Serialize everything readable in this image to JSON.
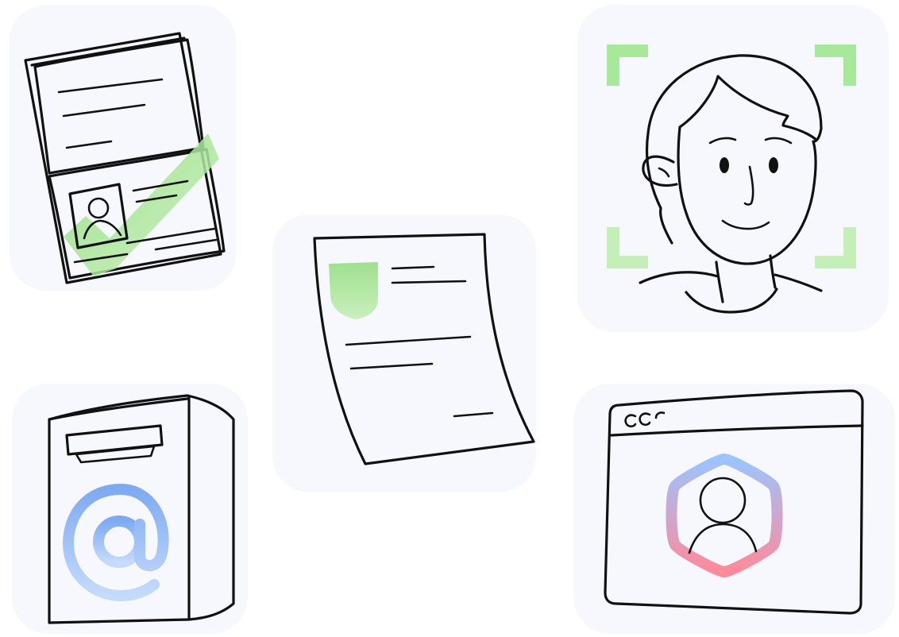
{
  "illustrations": [
    {
      "id": "passport",
      "icon": "passport-check-icon"
    },
    {
      "id": "document",
      "icon": "certificate-document-icon"
    },
    {
      "id": "face",
      "icon": "face-scan-icon"
    },
    {
      "id": "mailbox",
      "icon": "email-mailbox-icon"
    },
    {
      "id": "browser",
      "icon": "browser-profile-icon"
    }
  ],
  "colors": {
    "background": "#ffffff",
    "tile": "#f7f8fe",
    "ink": "#111111",
    "check_green": "#9fe08f",
    "email_blue": "#8fb8f5",
    "badge_gradient_top": "#9cc4ff",
    "badge_gradient_bottom": "#ff8a9a"
  }
}
